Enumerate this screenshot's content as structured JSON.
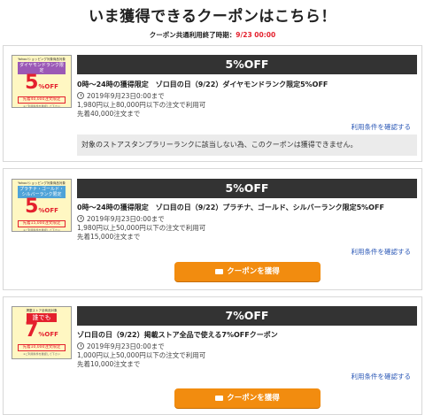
{
  "header": {
    "title": "いま獲得できるクーポンはこちら！",
    "deadline_label": "クーポン共通利用終了時期：",
    "deadline_value": "9/23 00:00"
  },
  "coupons": [
    {
      "thumb": {
        "head": "Yahoo!ショッピング対象商品対象",
        "rank": "ダイヤモンドランク限定",
        "rank_color": "#9b59b6",
        "prefix": "",
        "pct": "5",
        "off": "%OFF",
        "limit": "先着40,000注文限定",
        "foot": "※ご利用条件を確認して下さい",
        "bg": "#fff7c2"
      },
      "discount": "5%OFF",
      "name": "0時〜24時の獲得限定　ゾロ目の日（9/22）ダイヤモンドランク限定5%OFF",
      "period": "2019年9月23日0:00まで",
      "condition": "1,980円以上80,000円以下の注文で利用可",
      "limit": "先着40,000注文まで",
      "terms": "利用条件を確認する",
      "notice": "対象のストアスタンプラリーランクに該当しない為、このクーポンは獲得できません。",
      "button": ""
    },
    {
      "thumb": {
        "head": "Yahoo!ショッピング対象商品対象",
        "rank": "プラチナ・ゴールド・シルバーランク限定",
        "rank_color": "#4fa3d8",
        "prefix": "",
        "pct": "5",
        "off": "%OFF",
        "limit": "先着15,000注文限定",
        "foot": "※ご利用条件を確認して下さい",
        "bg": "#fff7c2"
      },
      "discount": "5%OFF",
      "name": "0時〜24時の獲得限定　ゾロ目の日（9/22）プラチナ、ゴールド、シルバーランク限定5%OFF",
      "period": "2019年9月23日0:00まで",
      "condition": "1,980円以上50,000円以下の注文で利用可",
      "limit": "先着15,000注文まで",
      "terms": "利用条件を確認する",
      "notice": "",
      "button": "クーポンを獲得"
    },
    {
      "thumb": {
        "head": "掲載ストア全商品対象",
        "rank": "",
        "rank_color": "",
        "prefix": "誰でも",
        "pct": "7",
        "off": "%OFF",
        "limit": "先着10,000注文限定",
        "foot": "※ご利用条件を確認して下さい",
        "bg": "#fff7c2"
      },
      "discount": "7%OFF",
      "name": "ゾロ目の日（9/22）掲載ストア全品で使える7%OFFクーポン",
      "period": "2019年9月23日0:00まで",
      "condition": "1,000円以上50,000円以下の注文で利用可",
      "limit": "先着10,000注文まで",
      "terms": "利用条件を確認する",
      "notice": "",
      "button": "クーポンを獲得"
    }
  ]
}
